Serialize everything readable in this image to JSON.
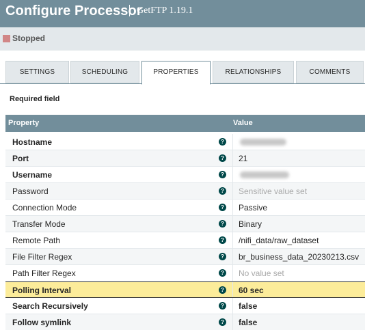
{
  "header": {
    "title": "Configure Processor",
    "subtitle": "GetFTP 1.19.1"
  },
  "status": {
    "text": "Stopped",
    "color": "#d18686"
  },
  "tabs": [
    {
      "label": "SETTINGS",
      "active": false
    },
    {
      "label": "SCHEDULING",
      "active": false
    },
    {
      "label": "PROPERTIES",
      "active": true
    },
    {
      "label": "RELATIONSHIPS",
      "active": false
    },
    {
      "label": "COMMENTS",
      "active": false
    }
  ],
  "required_field_label": "Required field",
  "table": {
    "col_property": "Property",
    "col_value": "Value",
    "help_glyph": "?",
    "rows": [
      {
        "name": "Hostname",
        "value": "",
        "required": true,
        "value_style": "redacted"
      },
      {
        "name": "Port",
        "value": "21",
        "required": true,
        "value_style": "normal"
      },
      {
        "name": "Username",
        "value": "",
        "required": true,
        "value_style": "redacted"
      },
      {
        "name": "Password",
        "value": "Sensitive value set",
        "required": false,
        "value_style": "muted"
      },
      {
        "name": "Connection Mode",
        "value": "Passive",
        "required": false,
        "value_style": "normal"
      },
      {
        "name": "Transfer Mode",
        "value": "Binary",
        "required": false,
        "value_style": "normal"
      },
      {
        "name": "Remote Path",
        "value": "/nifi_data/raw_dataset",
        "required": false,
        "value_style": "normal"
      },
      {
        "name": "File Filter Regex",
        "value": "br_business_data_20230213.csv",
        "required": false,
        "value_style": "normal"
      },
      {
        "name": "Path Filter Regex",
        "value": "No value set",
        "required": false,
        "value_style": "muted"
      },
      {
        "name": "Polling Interval",
        "value": "60 sec",
        "required": true,
        "value_style": "bold",
        "highlighted": true
      },
      {
        "name": "Search Recursively",
        "value": "false",
        "required": true,
        "value_style": "bold"
      },
      {
        "name": "Follow symlink",
        "value": "false",
        "required": true,
        "value_style": "bold"
      }
    ]
  },
  "colors": {
    "header": "#728e9b",
    "status_bg": "#e3e8eb",
    "highlight": "#fcec9a",
    "help_icon": "#004849"
  }
}
